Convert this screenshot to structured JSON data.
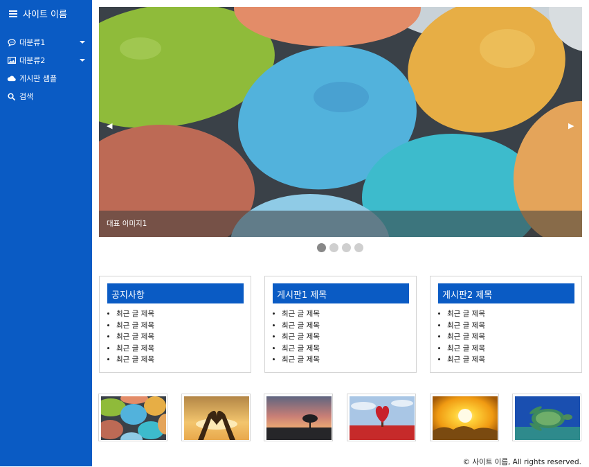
{
  "site": {
    "name": "사이트 이름"
  },
  "nav": {
    "items": [
      {
        "label": "대분류1",
        "icon": "chat-bubble-icon",
        "has_caret": true
      },
      {
        "label": "대분류2",
        "icon": "image-icon",
        "has_caret": true
      },
      {
        "label": "게시판 샘플",
        "icon": "cloud-icon",
        "has_caret": false
      },
      {
        "label": "검색",
        "icon": "search-icon",
        "has_caret": false
      }
    ]
  },
  "slider": {
    "caption": "대표 이미지1",
    "prev_label": "◀",
    "next_label": "▶",
    "slide_count": 4,
    "active_index": 0
  },
  "boards": [
    {
      "title": "공지사항",
      "items": [
        "최근 글 제목",
        "최근 글 제목",
        "최근 글 제목",
        "최근 글 제목",
        "최근 글 제목"
      ]
    },
    {
      "title": "게시판1 제목",
      "items": [
        "최근 글 제목",
        "최근 글 제목",
        "최근 글 제목",
        "최근 글 제목",
        "최근 글 제목"
      ]
    },
    {
      "title": "게시판2 제목",
      "items": [
        "최근 글 제목",
        "최근 글 제목",
        "최근 글 제목",
        "최근 글 제목",
        "최근 글 제목"
      ]
    }
  ],
  "gallery": [
    {
      "subject": "colored-eggs"
    },
    {
      "subject": "heart-hands-sunset"
    },
    {
      "subject": "lone-tree-dusk"
    },
    {
      "subject": "heart-tree-red-field"
    },
    {
      "subject": "sun-over-clouds"
    },
    {
      "subject": "sea-turtle-underwater"
    }
  ],
  "colors": {
    "brand": "#0a5bc4",
    "caption_bg": "#3c3c3c",
    "dot": "#cfcfcf",
    "dot_active": "#888888"
  },
  "footer": {
    "text": "© 사이트 이름, All rights reserved."
  }
}
